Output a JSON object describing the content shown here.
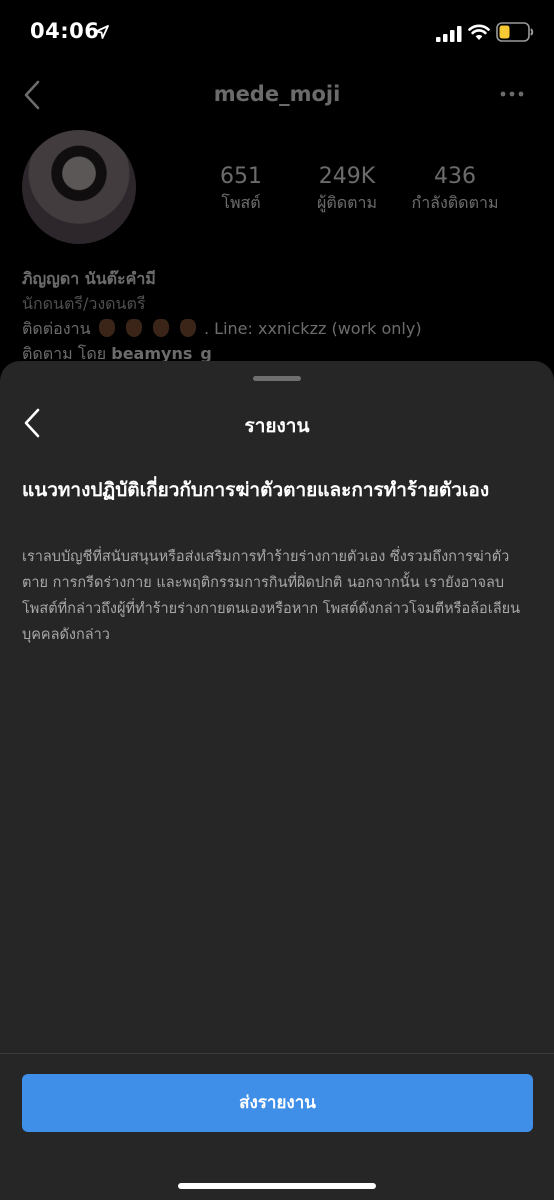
{
  "status_bar": {
    "time": "04:06",
    "icons": [
      "location-arrow-icon",
      "signal-icon",
      "wifi-icon",
      "battery-icon"
    ]
  },
  "profile": {
    "username": "mede_moji",
    "stats": [
      {
        "value": "651",
        "label": "โพสต์"
      },
      {
        "value": "249K",
        "label": "ผู้ติดตาม"
      },
      {
        "value": "436",
        "label": "กำลังติดตาม"
      }
    ],
    "name": "ภิญญดา นันต๊ะคำมี",
    "category": "นักดนตรี/วงดนตรี",
    "contact_prefix": "ติดต่องาน",
    "contact_suffix": ". Line: xxnickzz (work only)",
    "followed_by_prefix": "ติดตาม โดย",
    "followed_by_user": "beamyns_g"
  },
  "sheet": {
    "title": "รายงาน",
    "heading": "แนวทางปฏิบัติเกี่ยวกับการฆ่าตัวตายและการทำร้ายตัวเอง",
    "description": "เราลบบัญชีที่สนับสนุนหรือส่งเสริมการทำร้ายร่างกายตัวเอง ซึ่งรวมถึงการฆ่าตัวตาย การกรีดร่างกาย และพฤติกรรมการกินที่ผิดปกติ นอกจากนั้น เรายังอาจลบโพสต์ที่กล่าวถึงผู้ที่ทำร้ายร่างกายตนเองหรือหาก โพสต์ดังกล่าวโจมตีหรือล้อเลียนบุคคลดังกล่าว",
    "submit_label": "ส่งรายงาน"
  },
  "colors": {
    "sheet_bg": "#262626",
    "accent_button": "#3f8ee8",
    "secondary_text": "#a8a8a8"
  }
}
